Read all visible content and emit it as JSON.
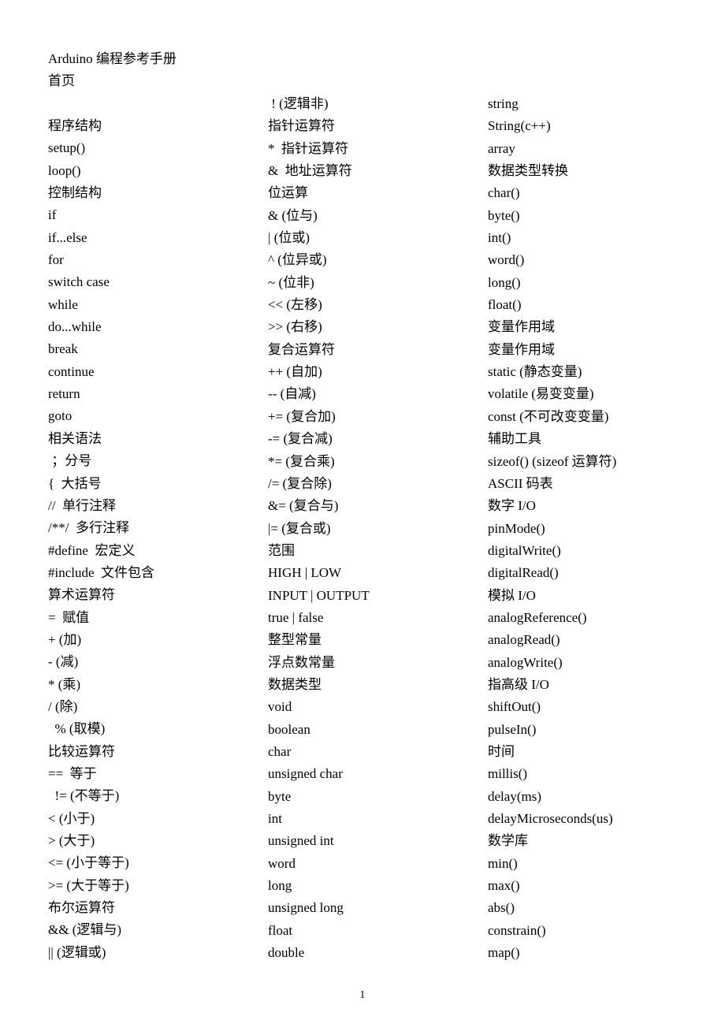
{
  "document": {
    "title": "Arduino 编程参考手册",
    "subtitle": "首页",
    "page_number": "1"
  },
  "columns": [
    {
      "items": [
        "程序结构",
        "setup()",
        "loop()",
        "控制结构",
        "if",
        "if...else",
        "for",
        "switch case",
        "while",
        "do...while",
        "break",
        "continue",
        "return",
        "goto",
        "相关语法",
        " ；分号",
        "{  大括号",
        "//  单行注释",
        "/**/  多行注释",
        "#define  宏定义",
        "#include  文件包含",
        "算术运算符",
        "=  赋值",
        "+ (加)",
        "- (减)",
        "* (乘)",
        "/ (除)",
        "  % (取模)",
        "比较运算符",
        "==  等于",
        "  != (不等于)",
        "< (小于)",
        "> (大于)",
        "<= (小于等于)",
        ">= (大于等于)",
        "布尔运算符",
        "&& (逻辑与)",
        "|| (逻辑或)"
      ]
    },
    {
      "items": [
        " ! (逻辑非)",
        "指针运算符",
        "*  指针运算符",
        "&  地址运算符",
        "位运算",
        "& (位与)",
        "| (位或)",
        "^ (位异或)",
        "~ (位非)",
        "<< (左移)",
        ">> (右移)",
        "复合运算符",
        "++ (自加)",
        "-- (自减)",
        "+= (复合加)",
        "-= (复合减)",
        "*= (复合乘)",
        "/= (复合除)",
        "&= (复合与)",
        "|= (复合或)",
        "范围",
        "HIGH | LOW",
        "INPUT | OUTPUT",
        "true | false",
        "整型常量",
        "浮点数常量",
        "数据类型",
        "void",
        "boolean",
        "char",
        "unsigned char",
        "byte",
        "int",
        "unsigned int",
        "word",
        "long",
        "unsigned long",
        "float",
        "double"
      ]
    },
    {
      "items": [
        "string",
        "String(c++)",
        "array",
        "数据类型转换",
        "char()",
        "byte()",
        "int()",
        "word()",
        "long()",
        "float()",
        "变量作用域",
        "变量作用域",
        "static (静态变量)",
        "volatile (易变变量)",
        "const (不可改变变量)",
        "辅助工具",
        "sizeof() (sizeof 运算符)",
        "ASCII 码表",
        "数字 I/O",
        "pinMode()",
        "digitalWrite()",
        "digitalRead()",
        "模拟 I/O",
        "analogReference()",
        "analogRead()",
        "analogWrite()",
        "指高级 I/O",
        "shiftOut()",
        "pulseIn()",
        "时间",
        "millis()",
        "delay(ms)",
        "delayMicroseconds(us)",
        "数学库",
        "min()",
        "max()",
        "abs()",
        "constrain()",
        "map()"
      ]
    }
  ]
}
